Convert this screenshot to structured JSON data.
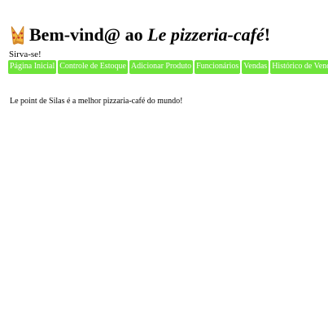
{
  "header": {
    "logo_icon": "pizza-icon",
    "title_prefix": "Bem-vind@ ao ",
    "title_name": "Le pizzeria-café",
    "title_suffix": "!"
  },
  "subtitle": "Sirva-se!",
  "nav": {
    "accent_color": "#6ee43a",
    "items": [
      {
        "label": "Página Inicial"
      },
      {
        "label": "Controle de Estoque"
      },
      {
        "label": "Adicionar Produto"
      },
      {
        "label": "Funcionários"
      },
      {
        "label": "Vendas"
      },
      {
        "label": "Histórico de Vendas"
      }
    ]
  },
  "main": {
    "text": "Le point de Silas é a melhor pizzaria-café do mundo!"
  }
}
